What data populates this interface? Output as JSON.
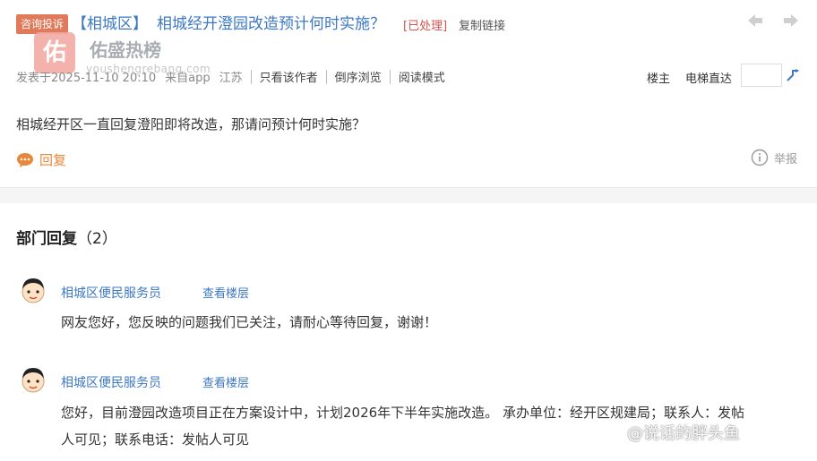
{
  "header": {
    "category_badge": "咨询投诉",
    "area": "【相城区】",
    "title": "相城经开澄园改造预计何时实施？",
    "status": "[已处理]",
    "copy_link": "复制链接"
  },
  "watermark": {
    "logo_char": "佑",
    "name": "佑盛热榜",
    "url": "youshengrebang.com",
    "bottom": "@说话的胖头鱼"
  },
  "meta": {
    "posted": "发表于2025-11-10 20:10",
    "source": "来自app",
    "region": "江苏",
    "only_author": "只看该作者",
    "reverse_browse": "倒序浏览",
    "read_mode": "阅读模式",
    "floor_owner": "楼主",
    "elevator": "电梯直达"
  },
  "question": {
    "text": "相城经开区一直回复澄阳即将改造，那请问预计何时实施？",
    "reply_label": "回复",
    "report_label": "举报"
  },
  "replies": {
    "section_title": "部门回复",
    "count": "（2）",
    "items": [
      {
        "author": "相城区便民服务员",
        "view_floor": "查看楼层",
        "line1": "网友您好，您反映的问题我们已关注，请耐心等待回复，谢谢！",
        "line2": ""
      },
      {
        "author": "相城区便民服务员",
        "view_floor": "查看楼层",
        "line1": "您好，目前澄园改造项目正在方案设计中，计划2026年下半年实施改造。 承办单位：经开区规建局；联系人：发帖",
        "line2": "人可见；联系电话：发帖人可见"
      }
    ]
  },
  "colors": {
    "link_blue": "#3c78c3",
    "status_red": "#d9534f",
    "reply_orange": "#e8873a",
    "badge_orange": "#e07a5a"
  }
}
